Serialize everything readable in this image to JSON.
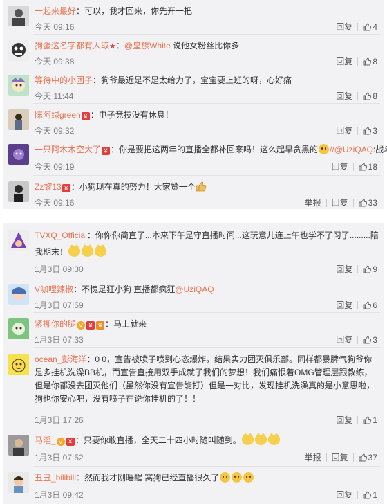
{
  "actions": {
    "reply": "回复",
    "report": "举报"
  },
  "panel1": [
    {
      "user": "一起来最好",
      "sep": "：",
      "text": "可以，我才回来，你先开一把",
      "time": "今天 09:16",
      "likes": "4"
    },
    {
      "user": "狗蛋这名字都有人取",
      "sep": "：",
      "at": "@皇族White",
      "text": " 说他女粉丝比你多",
      "time": "今天 09:38",
      "likes": "8"
    },
    {
      "user": "等待中的小团子",
      "sep": "：",
      "text": "狗爷最近是不是太给力了，宝宝要上班的呀，心好痛",
      "time": "今天 11:44",
      "likes": "8"
    },
    {
      "user": "陈阿绿green",
      "sep": "：",
      "text": "电子竞技没有休息！",
      "time": "今天 09:32",
      "likes": "3"
    },
    {
      "user": "一只阿木木空大了",
      "sep": "：",
      "text": "你是要把这两年的直播全都补回来吗！这么起早贪黑的",
      "at": "//@UziQAQ",
      "text2": ":战斗",
      "time": "今天 09:19",
      "likes": "18"
    },
    {
      "user": "Zz黎13",
      "sep": "：",
      "text": "小狗现在真的努力！大家赞一个",
      "time": "今天 09:16",
      "likes": "33"
    }
  ],
  "panel2": [
    {
      "user": "TVXQ_Official",
      "sep": "：",
      "text": "你你你简直了...本来下午是守直播时间...这玩意儿连上午也学不了习了.........陪",
      "text2": "我期末！",
      "time": "1月3日 09:30",
      "likes": "9"
    },
    {
      "user": "V咖哩辣椒",
      "sep": "：",
      "text": "不愧是狂小狗 直播都疯狂",
      "at": "@UziQAQ",
      "time": "1月3日 07:59",
      "likes": "6"
    },
    {
      "user": "紧挪你的腿",
      "sep": "：",
      "text": "马上就来",
      "time": "1月3日 07:33",
      "likes": "3"
    },
    {
      "user": "ocean_彭海洋",
      "sep": "：",
      "text": "0 0，宣告被喷子喷到心态爆炸，结果实力团灭俱乐部。同样都暴脾气狗爷你是多挂机洗澡BB机，而宣告直接用双手成就了我们的梦想！我们痛恨着OMG管理层跟教练，但是你都没去团灭他们（虽然你没有宣告能打）但是一对比，发现挂机洗澡真的是小意思啦，狗也你安心吧，没有喷子在说你挂机的了！！",
      "time": "1月3日 17:26",
      "likes": "1"
    },
    {
      "user": "马滔_",
      "sep": "：",
      "text": "只要你敢直播，全天二十四小时随叫随到。",
      "time": "1月3日 07:52",
      "likes": "37"
    },
    {
      "user": "丑丑_bilibili",
      "sep": "：",
      "text": "然而我才刚睡醒 窝狗已经直播很久了",
      "time": "1月3日 09:42",
      "likes": "1"
    }
  ]
}
